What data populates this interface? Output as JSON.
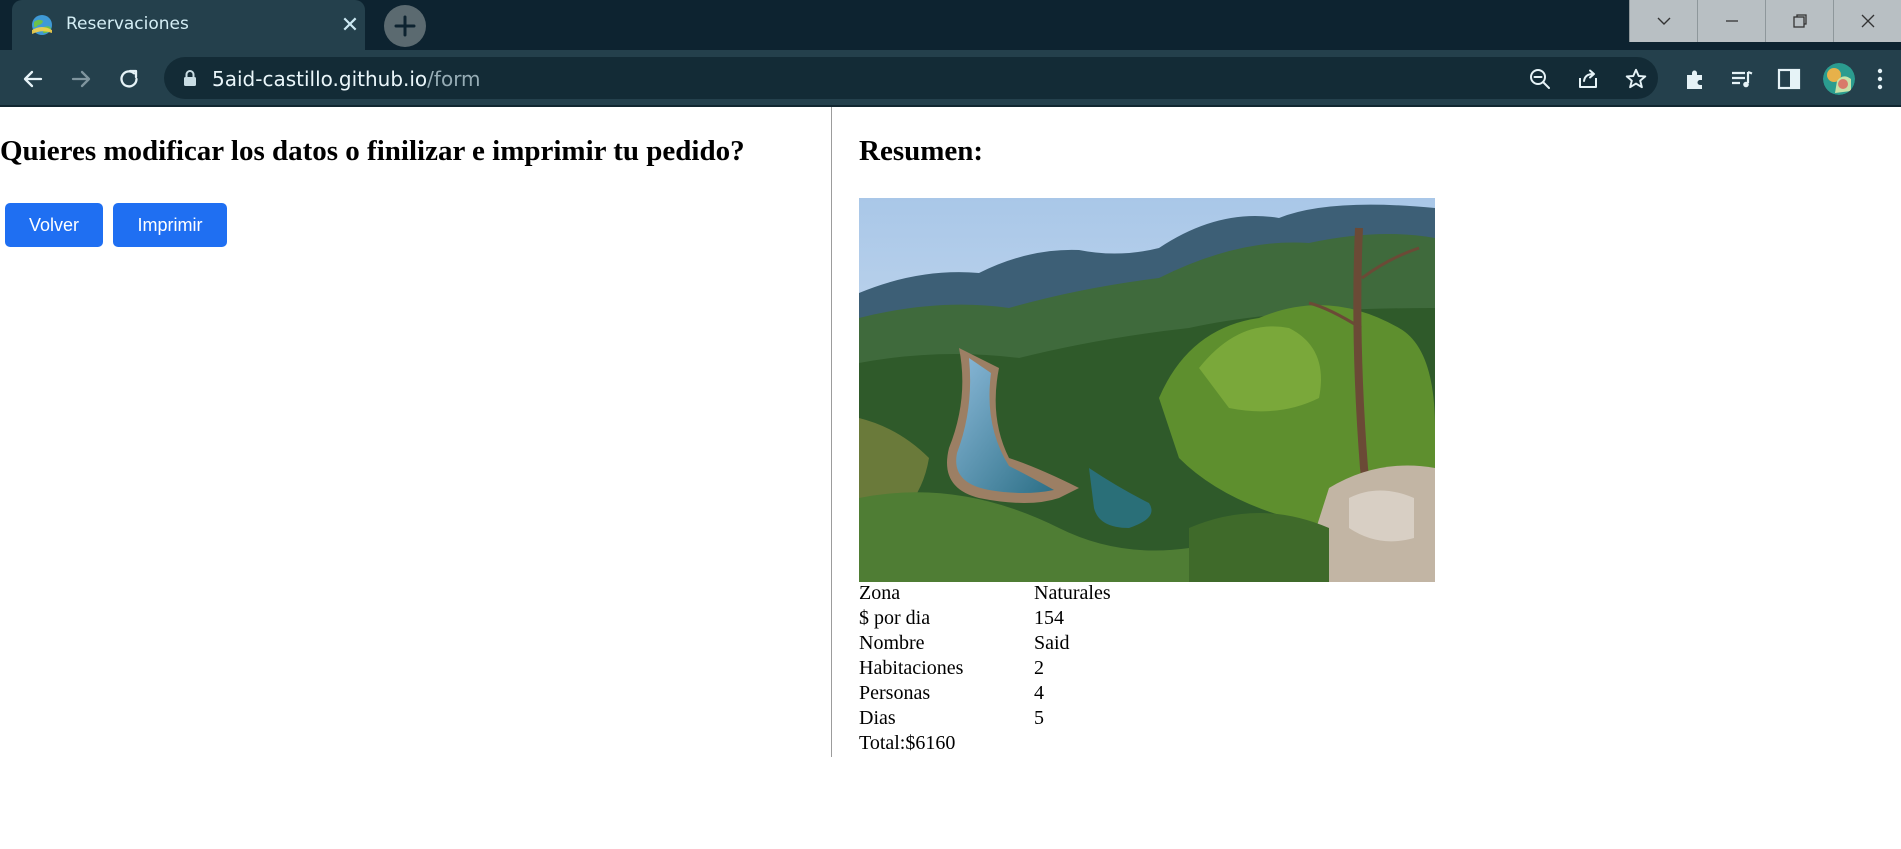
{
  "browser": {
    "tab": {
      "title": "Reservaciones",
      "favicon": "globe-icon"
    },
    "url": {
      "host": "5aid-castillo.github.io",
      "path": "/form"
    },
    "colors": {
      "frame": "#0d2330",
      "toolbar": "#24404c",
      "omnibox": "#132b36"
    }
  },
  "page": {
    "question": "Quieres modificar los datos o finilizar e imprimir tu pedido?",
    "buttons": {
      "back": "Volver",
      "print": "Imprimir"
    },
    "summary": {
      "title": "Resumen:",
      "image": "mountain-river-landscape",
      "rows": [
        {
          "label": "Zona",
          "value": "Naturales"
        },
        {
          "label": "$ por dia",
          "value": "154"
        },
        {
          "label": "Nombre",
          "value": "Said"
        },
        {
          "label": "Habitaciones",
          "value": "2"
        },
        {
          "label": "Personas",
          "value": "4"
        },
        {
          "label": "Dias",
          "value": "5"
        }
      ],
      "total": "Total:$6160"
    },
    "colors": {
      "button": "#1f6ff2"
    }
  }
}
